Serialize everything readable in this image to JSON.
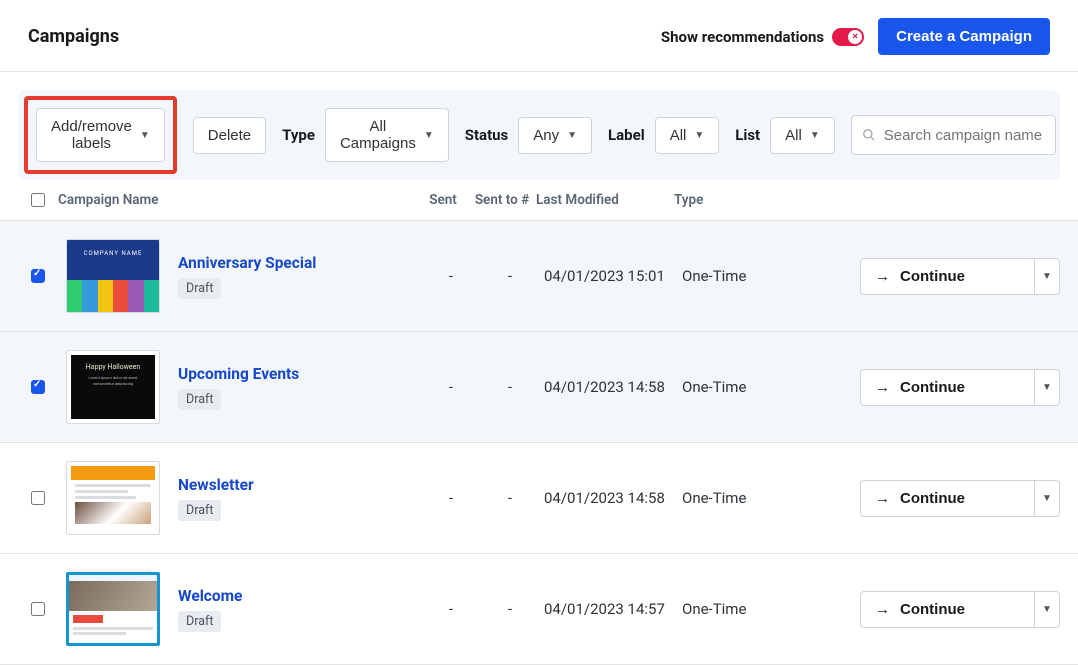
{
  "header": {
    "title": "Campaigns",
    "show_recommendations_label": "Show recommendations",
    "create_button": "Create a Campaign"
  },
  "toolbar": {
    "labels_button": "Add/remove labels",
    "delete_button": "Delete",
    "type_label": "Type",
    "type_value": "All Campaigns",
    "status_label": "Status",
    "status_value": "Any",
    "label_label": "Label",
    "label_value": "All",
    "list_label": "List",
    "list_value": "All",
    "search_placeholder": "Search campaign name"
  },
  "columns": {
    "name": "Campaign Name",
    "sent": "Sent",
    "sent_to": "Sent to #",
    "modified": "Last Modified",
    "type": "Type"
  },
  "rows": [
    {
      "selected": true,
      "name": "Anniversary Special",
      "status_badge": "Draft",
      "sent": "-",
      "sent_to": "-",
      "modified": "04/01/2023 15:01",
      "type": "One-Time",
      "action": "Continue"
    },
    {
      "selected": true,
      "name": "Upcoming Events",
      "status_badge": "Draft",
      "sent": "-",
      "sent_to": "-",
      "modified": "04/01/2023 14:58",
      "type": "One-Time",
      "action": "Continue"
    },
    {
      "selected": false,
      "name": "Newsletter",
      "status_badge": "Draft",
      "sent": "-",
      "sent_to": "-",
      "modified": "04/01/2023 14:58",
      "type": "One-Time",
      "action": "Continue"
    },
    {
      "selected": false,
      "name": "Welcome",
      "status_badge": "Draft",
      "sent": "-",
      "sent_to": "-",
      "modified": "04/01/2023 14:57",
      "type": "One-Time",
      "action": "Continue"
    }
  ]
}
